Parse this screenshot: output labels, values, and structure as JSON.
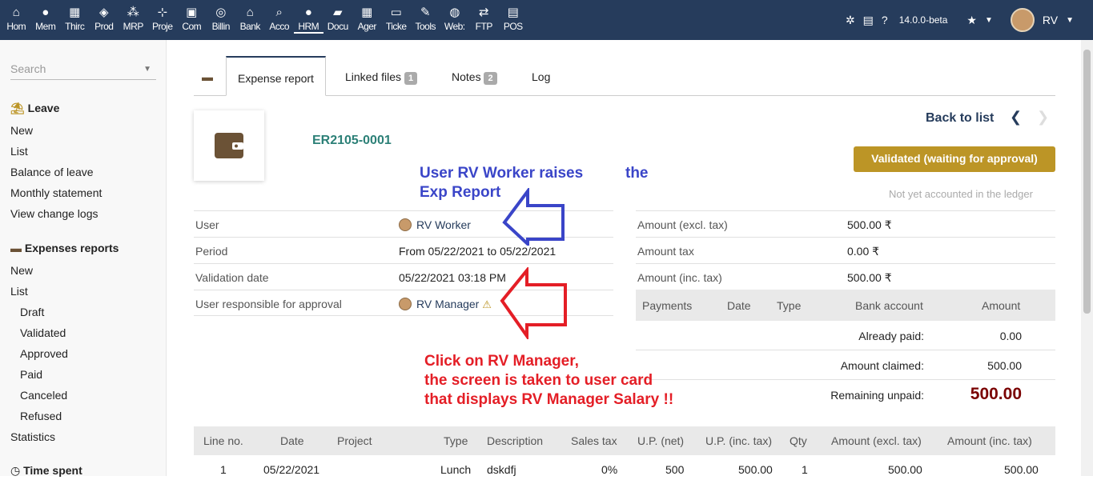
{
  "topmenu": [
    {
      "label": "Hom",
      "icon": "home-icon",
      "glyph": "⌂"
    },
    {
      "label": "Mem",
      "icon": "members-icon",
      "glyph": "●"
    },
    {
      "label": "Thirc",
      "icon": "building-icon",
      "glyph": "▦"
    },
    {
      "label": "Prod",
      "icon": "cube-icon",
      "glyph": "◈"
    },
    {
      "label": "MRP",
      "icon": "cubes-icon",
      "glyph": "⁂"
    },
    {
      "label": "Proje",
      "icon": "project-icon",
      "glyph": "⊹"
    },
    {
      "label": "Com",
      "icon": "suitcase-icon",
      "glyph": "▣"
    },
    {
      "label": "Billin",
      "icon": "coins-icon",
      "glyph": "◎"
    },
    {
      "label": "Bank",
      "icon": "bank-icon",
      "glyph": "⌂"
    },
    {
      "label": "Acco",
      "icon": "search-dollar-icon",
      "glyph": "⌕"
    },
    {
      "label": "HRM",
      "icon": "user-tie-icon",
      "glyph": "●"
    },
    {
      "label": "Docu",
      "icon": "folder-icon",
      "glyph": "▰"
    },
    {
      "label": "Ager",
      "icon": "calendar-icon",
      "glyph": "▦"
    },
    {
      "label": "Ticke",
      "icon": "ticket-icon",
      "glyph": "▭"
    },
    {
      "label": "Tools",
      "icon": "wrench-icon",
      "glyph": "✎"
    },
    {
      "label": "Web:",
      "icon": "globe-icon",
      "glyph": "◍"
    },
    {
      "label": "FTP",
      "icon": "exchange-icon",
      "glyph": "⇄"
    },
    {
      "label": "POS",
      "icon": "cash-register-icon",
      "glyph": "▤"
    }
  ],
  "topright": {
    "version": "14.0.0-beta",
    "user": "RV"
  },
  "sidebar": {
    "search_placeholder": "Search",
    "leave_title": "Leave",
    "leave_items": [
      "New",
      "List",
      "Balance of leave",
      "Monthly statement",
      "View change logs"
    ],
    "expenses_title": "Expenses reports",
    "exp_items": [
      "New",
      "List"
    ],
    "exp_sub": [
      "Draft",
      "Validated",
      "Approved",
      "Paid",
      "Canceled",
      "Refused"
    ],
    "statistics": "Statistics",
    "time_title": "Time spent"
  },
  "tabs": {
    "expense": "Expense report",
    "linked": "Linked files",
    "linked_count": "1",
    "notes": "Notes",
    "notes_count": "2",
    "log": "Log"
  },
  "header": {
    "ref": "ER2105-0001",
    "back": "Back to list",
    "status": "Validated (waiting for approval)",
    "ledger": "Not yet accounted in the ledger"
  },
  "fields": {
    "user_k": "User",
    "user_v": "RV Worker",
    "period_k": "Period",
    "period_v": "From 05/22/2021 to 05/22/2021",
    "valid_k": "Validation date",
    "valid_v": "05/22/2021 03:18 PM",
    "resp_k": "User responsible for approval",
    "resp_v": "RV Manager"
  },
  "amounts": {
    "excl_k": "Amount (excl. tax)",
    "excl_v": "500.00 ₹",
    "tax_k": "Amount tax",
    "tax_v": "0.00 ₹",
    "inc_k": "Amount (inc. tax)",
    "inc_v": "500.00 ₹"
  },
  "payments": {
    "h_payments": "Payments",
    "h_date": "Date",
    "h_type": "Type",
    "h_bank": "Bank account",
    "h_amount": "Amount",
    "paid_k": "Already paid:",
    "paid_v": "0.00",
    "claimed_k": "Amount claimed:",
    "claimed_v": "500.00",
    "remain_k": "Remaining unpaid:",
    "remain_v": "500.00"
  },
  "lines": {
    "headers": [
      "Line no.",
      "Date",
      "Project",
      "Type",
      "Description",
      "Sales tax",
      "U.P. (net)",
      "U.P. (inc. tax)",
      "Qty",
      "Amount (excl. tax)",
      "Amount (inc. tax)"
    ],
    "row": [
      "1",
      "05/22/2021",
      "",
      "Lunch",
      "dskdfj",
      "0%",
      "500",
      "500.00",
      "1",
      "500.00",
      "500.00"
    ]
  },
  "annotations": {
    "blue1": "User RV Worker raises",
    "blue_the": "the",
    "blue2": "Exp Report",
    "red1": "Click on RV Manager,",
    "red2": "the screen is taken to user card",
    "red3": "that displays RV Manager Salary !!",
    "blue_color": "#3a45c8",
    "red_color": "#e41e26"
  }
}
